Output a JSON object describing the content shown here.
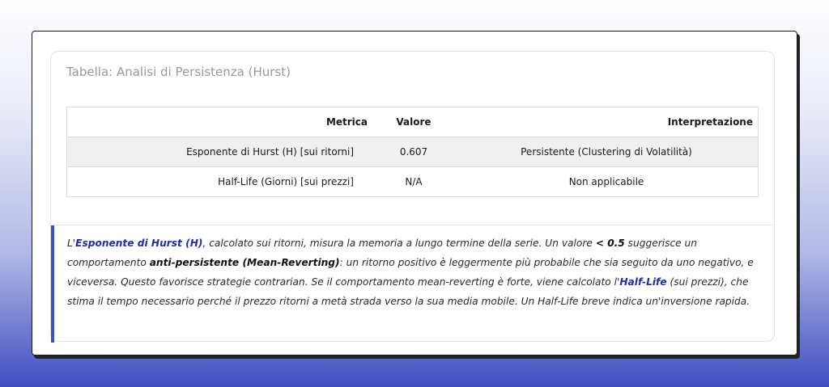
{
  "card": {
    "title": "Tabella: Analisi di Persistenza (Hurst)"
  },
  "table": {
    "headers": [
      "Metrica",
      "Valore",
      "Interpretazione"
    ],
    "rows": [
      [
        "Esponente di Hurst (H) [sui ritorni]",
        "0.607",
        "Persistente (Clustering di Volatilità)"
      ],
      [
        "Half-Life (Giorni) [sui prezzi]",
        "N/A",
        "Non applicabile"
      ]
    ]
  },
  "note": {
    "p1": "L'",
    "b1": "Esponente di Hurst (H)",
    "p2": ", calcolato sui ritorni, misura la memoria a lungo termine della serie. Un valore ",
    "b2": "< 0.5",
    "p3": " suggerisce un comportamento ",
    "b3": "anti-persistente (Mean-Reverting)",
    "p4": ": un ritorno positivo è leggermente più probabile che sia seguito da uno negativo, e viceversa. Questo favorisce strategie contrarian. Se il comportamento mean-reverting è forte, viene calcolato l'",
    "b4": "Half-Life",
    "p5": " (sui prezzi), che stima il tempo necessario perché il prezzo ritorni a metà strada verso la sua media mobile. Un Half-Life breve indica un'inversione rapida."
  },
  "colors": {
    "accent": "#3c4fc9",
    "row_shade": "#f0f0f0"
  }
}
